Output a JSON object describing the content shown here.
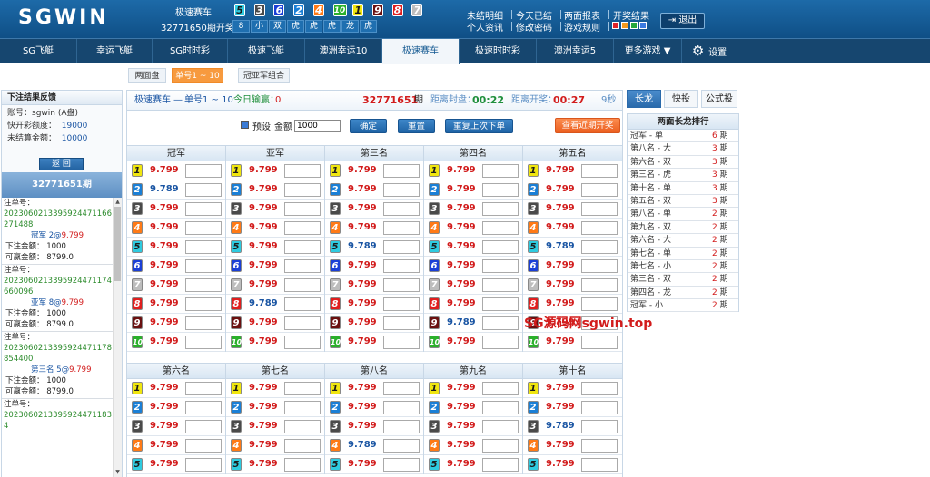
{
  "header": {
    "logo": "SGWIN",
    "game_name": "极速赛车",
    "issue_label": "32771650期开奖",
    "results": [
      {
        "n": "5",
        "c": "#2ecbe0",
        "fc": "#1a1a1a"
      },
      {
        "n": "3",
        "c": "#4a4a4a",
        "fc": "#ffffff"
      },
      {
        "n": "6",
        "c": "#1a3fd6",
        "fc": "#ffffff"
      },
      {
        "n": "2",
        "c": "#1a7fd6",
        "fc": "#ffffff"
      },
      {
        "n": "4",
        "c": "#ff7a16",
        "fc": "#ffffff"
      },
      {
        "n": "10",
        "c": "#2bb02b",
        "fc": "#ffffff"
      },
      {
        "n": "1",
        "c": "#f0e60f",
        "fc": "#1a1a1a"
      },
      {
        "n": "9",
        "c": "#6a1010",
        "fc": "#ffffff"
      },
      {
        "n": "8",
        "c": "#e01e1e",
        "fc": "#ffffff"
      },
      {
        "n": "7",
        "c": "#bdbdbd",
        "fc": "#ffffff"
      }
    ],
    "summary": [
      "8",
      "小",
      "双",
      "虎",
      "虎",
      "虎",
      "龙",
      "虎"
    ],
    "links_row1": [
      "未结明细",
      "今天已结",
      "两面报表",
      "开奖结果"
    ],
    "links_row2": [
      "个人资讯",
      "修改密码",
      "游戏规则"
    ],
    "theme_colors": [
      "#e0242a",
      "#f39a1e",
      "#27a83c",
      "#3b7be0"
    ],
    "logout": "退出"
  },
  "nav": [
    "SG飞艇",
    "幸运飞艇",
    "SG时时彩",
    "极速飞艇",
    "澳洲幸运10",
    "极速赛车",
    "极速时时彩",
    "澳洲幸运5",
    "更多游戏 ▼",
    "设置"
  ],
  "subtabs": [
    "两面盘",
    "单号1 ~ 10",
    "冠亚军组合"
  ],
  "left": {
    "title": "下注结果反馈",
    "account_label": "账号：",
    "account": "sgwin (A盘)",
    "credit_label": "快开彩额度：",
    "credit": "19000",
    "unsettled_label": "未结算金额：",
    "unsettled": "10000",
    "back": "返 回",
    "issue": "32771651期",
    "orders": [
      {
        "label": "注单号：",
        "code": "2023060213395924471166271488",
        "pick_name": "冠军",
        "pick_num": "2@",
        "odds": "9.799",
        "bet_label": "下注金额：",
        "bet": "1000",
        "win_label": "可赢金额：",
        "win": "8799.0"
      },
      {
        "label": "注单号：",
        "code": "2023060213395924471174660096",
        "pick_name": "亚军",
        "pick_num": "8@",
        "odds": "9.799",
        "bet_label": "下注金额：",
        "bet": "1000",
        "win_label": "可赢金额：",
        "win": "8799.0"
      },
      {
        "label": "注单号：",
        "code": "2023060213395924471178854400",
        "pick_name": "第三名",
        "pick_num": "5@",
        "odds": "9.799",
        "bet_label": "下注金额：",
        "bet": "1000",
        "win_label": "可赢金额：",
        "win": "8799.0"
      },
      {
        "label": "注单号：",
        "code": "20230602133959244711834",
        "pick_name": "",
        "pick_num": "",
        "odds": "",
        "bet_label": "",
        "bet": "",
        "win_label": "",
        "win": ""
      }
    ]
  },
  "main": {
    "game": "极速赛车",
    "dash": "—",
    "tab": "单号1 ~ 10",
    "today_label": "今日输赢：",
    "today": "0",
    "issue": "32771651",
    "issue_unit": "期",
    "close_label": "距离封盘：",
    "close_time": "00:22",
    "draw_label": "距离开奖：",
    "draw_time": "00:27",
    "refresh": "9秒",
    "preset": "预设",
    "amount_label": "金额",
    "amount": "1000",
    "confirm": "确定",
    "reset": "重置",
    "repeat": "重复上次下单",
    "recent": "查看近期开奖",
    "groups": [
      {
        "name": "冠军",
        "odds": [
          "9.799",
          "9.789",
          "9.799",
          "9.799",
          "9.799",
          "9.799",
          "9.799",
          "9.799",
          "9.799",
          "9.799"
        ]
      },
      {
        "name": "亚军",
        "odds": [
          "9.799",
          "9.799",
          "9.799",
          "9.799",
          "9.799",
          "9.799",
          "9.799",
          "9.789",
          "9.799",
          "9.799"
        ]
      },
      {
        "name": "第三名",
        "odds": [
          "9.799",
          "9.799",
          "9.799",
          "9.799",
          "9.789",
          "9.799",
          "9.799",
          "9.799",
          "9.799",
          "9.799"
        ]
      },
      {
        "name": "第四名",
        "odds": [
          "9.799",
          "9.799",
          "9.799",
          "9.799",
          "9.799",
          "9.799",
          "9.799",
          "9.799",
          "9.789",
          "9.799"
        ]
      },
      {
        "name": "第五名",
        "odds": [
          "9.799",
          "9.799",
          "9.799",
          "9.799",
          "9.789",
          "9.799",
          "9.799",
          "9.799",
          "9.799",
          "9.799"
        ]
      },
      {
        "name": "第六名",
        "odds": [
          "9.799",
          "9.799",
          "9.799",
          "9.799",
          "9.799"
        ]
      },
      {
        "name": "第七名",
        "odds": [
          "9.799",
          "9.799",
          "9.799",
          "9.799",
          "9.799"
        ]
      },
      {
        "name": "第八名",
        "odds": [
          "9.799",
          "9.799",
          "9.799",
          "9.789",
          "9.799"
        ]
      },
      {
        "name": "第九名",
        "odds": [
          "9.799",
          "9.799",
          "9.799",
          "9.799",
          "9.799"
        ]
      },
      {
        "name": "第十名",
        "odds": [
          "9.799",
          "9.799",
          "9.789",
          "9.799",
          "9.799"
        ]
      }
    ],
    "balls": [
      {
        "n": "1",
        "c": "#f0e60f",
        "fc": "#1a1a1a"
      },
      {
        "n": "2",
        "c": "#1a7fd6",
        "fc": "#ffffff"
      },
      {
        "n": "3",
        "c": "#4a4a4a",
        "fc": "#ffffff"
      },
      {
        "n": "4",
        "c": "#ff7a16",
        "fc": "#ffffff"
      },
      {
        "n": "5",
        "c": "#2ecbe0",
        "fc": "#1a1a1a"
      },
      {
        "n": "6",
        "c": "#1a3fd6",
        "fc": "#ffffff"
      },
      {
        "n": "7",
        "c": "#bdbdbd",
        "fc": "#ffffff"
      },
      {
        "n": "8",
        "c": "#e01e1e",
        "fc": "#ffffff"
      },
      {
        "n": "9",
        "c": "#6a1010",
        "fc": "#ffffff"
      },
      {
        "n": "10",
        "c": "#2bb02b",
        "fc": "#ffffff"
      }
    ],
    "watermark": "SG源码网sgwin.top"
  },
  "right": {
    "tabs": [
      "长龙",
      "快投",
      "公式投"
    ],
    "title": "两面长龙排行",
    "unit": "期",
    "rows": [
      {
        "name": "冠军 - 单",
        "count": "6"
      },
      {
        "name": "第八名 - 大",
        "count": "3"
      },
      {
        "name": "第六名 - 双",
        "count": "3"
      },
      {
        "name": "第三名 - 虎",
        "count": "3"
      },
      {
        "name": "第十名 - 单",
        "count": "3"
      },
      {
        "name": "第五名 - 双",
        "count": "3"
      },
      {
        "name": "第八名 - 单",
        "count": "2"
      },
      {
        "name": "第九名 - 双",
        "count": "2"
      },
      {
        "name": "第六名 - 大",
        "count": "2"
      },
      {
        "name": "第七名 - 单",
        "count": "2"
      },
      {
        "name": "第七名 - 小",
        "count": "2"
      },
      {
        "name": "第三名 - 双",
        "count": "2"
      },
      {
        "name": "第四名 - 龙",
        "count": "2"
      },
      {
        "name": "冠军 - 小",
        "count": "2"
      }
    ]
  }
}
